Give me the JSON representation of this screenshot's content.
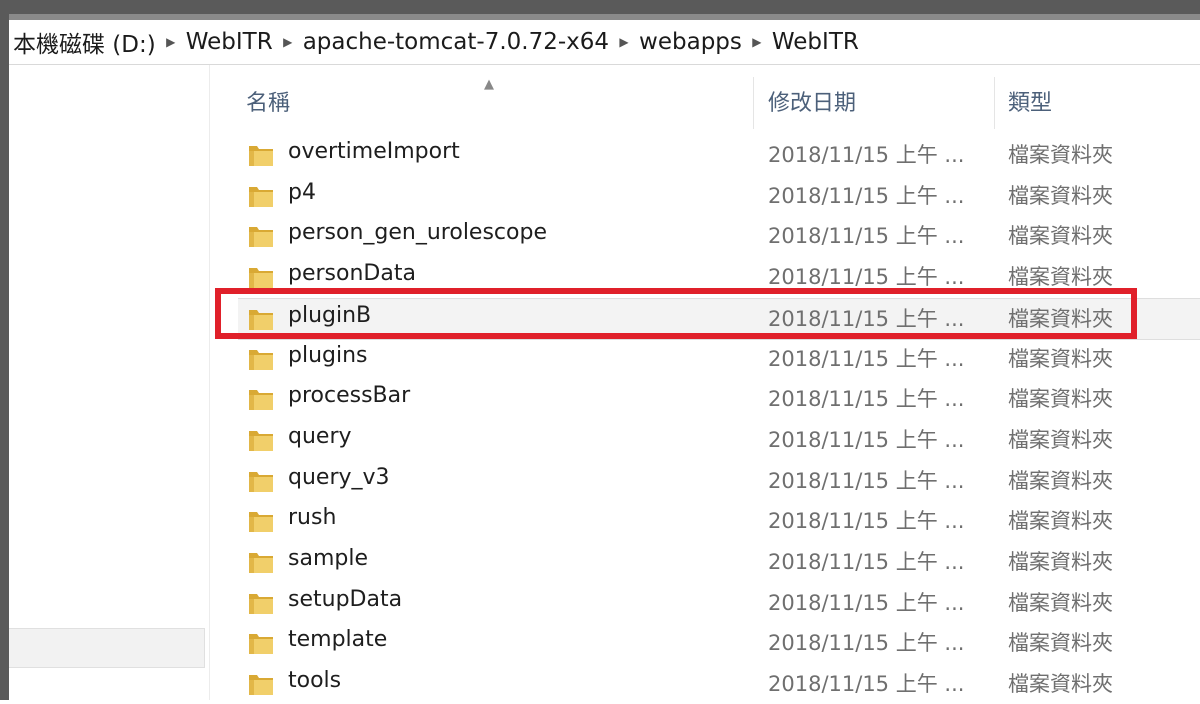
{
  "breadcrumb": {
    "items": [
      "本機磁碟 (D:)",
      "WebITR",
      "apache-tomcat-7.0.72-x64",
      "webapps",
      "WebITR"
    ]
  },
  "columns": {
    "name": "名稱",
    "modified": "修改日期",
    "type": "類型"
  },
  "files": [
    {
      "name": "overtimeImport",
      "date": "2018/11/15 上午 ...",
      "type": "檔案資料夾"
    },
    {
      "name": "p4",
      "date": "2018/11/15 上午 ...",
      "type": "檔案資料夾"
    },
    {
      "name": "person_gen_urolescope",
      "date": "2018/11/15 上午 ...",
      "type": "檔案資料夾"
    },
    {
      "name": "personData",
      "date": "2018/11/15 上午 ...",
      "type": "檔案資料夾"
    },
    {
      "name": "pluginB",
      "date": "2018/11/15 上午 ...",
      "type": "檔案資料夾"
    },
    {
      "name": "plugins",
      "date": "2018/11/15 上午 ...",
      "type": "檔案資料夾"
    },
    {
      "name": "processBar",
      "date": "2018/11/15 上午 ...",
      "type": "檔案資料夾"
    },
    {
      "name": "query",
      "date": "2018/11/15 上午 ...",
      "type": "檔案資料夾"
    },
    {
      "name": "query_v3",
      "date": "2018/11/15 上午 ...",
      "type": "檔案資料夾"
    },
    {
      "name": "rush",
      "date": "2018/11/15 上午 ...",
      "type": "檔案資料夾"
    },
    {
      "name": "sample",
      "date": "2018/11/15 上午 ...",
      "type": "檔案資料夾"
    },
    {
      "name": "setupData",
      "date": "2018/11/15 上午 ...",
      "type": "檔案資料夾"
    },
    {
      "name": "template",
      "date": "2018/11/15 上午 ...",
      "type": "檔案資料夾"
    },
    {
      "name": "tools",
      "date": "2018/11/15 上午 ...",
      "type": "檔案資料夾"
    }
  ],
  "highlighted_file": "pluginB",
  "colors": {
    "annotation": "#e0202a",
    "folder": "#e8c15a",
    "header_text": "#4c607a"
  },
  "icons": {
    "folder": "folder-icon",
    "separator": "chevron-right-icon",
    "sort": "sort-up-icon"
  }
}
